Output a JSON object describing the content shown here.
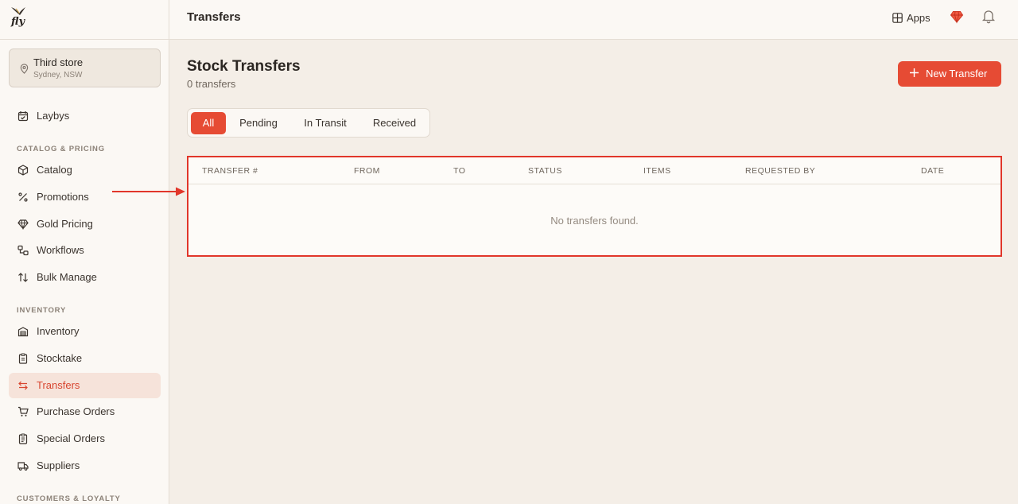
{
  "brand": {
    "logo_text": "fly"
  },
  "store": {
    "name": "Third store",
    "location": "Sydney, NSW"
  },
  "sidebar": {
    "top_items": [
      {
        "label": "Laybys",
        "icon": "calendar-check-icon"
      }
    ],
    "sections": [
      {
        "title": "CATALOG & PRICING",
        "items": [
          {
            "label": "Catalog",
            "icon": "box-icon"
          },
          {
            "label": "Promotions",
            "icon": "percent-icon"
          },
          {
            "label": "Gold Pricing",
            "icon": "diamond-icon"
          },
          {
            "label": "Workflows",
            "icon": "workflow-icon"
          },
          {
            "label": "Bulk Manage",
            "icon": "arrows-up-down-icon"
          }
        ]
      },
      {
        "title": "INVENTORY",
        "items": [
          {
            "label": "Inventory",
            "icon": "warehouse-icon"
          },
          {
            "label": "Stocktake",
            "icon": "clipboard-icon"
          },
          {
            "label": "Transfers",
            "icon": "transfer-arrows-icon",
            "active": true
          },
          {
            "label": "Purchase Orders",
            "icon": "cart-icon"
          },
          {
            "label": "Special Orders",
            "icon": "clipboard-list-icon"
          },
          {
            "label": "Suppliers",
            "icon": "truck-icon"
          }
        ]
      },
      {
        "title": "CUSTOMERS & LOYALTY",
        "items": []
      }
    ]
  },
  "topbar": {
    "title": "Transfers",
    "apps_label": "Apps"
  },
  "main": {
    "heading": "Stock Transfers",
    "count_text": "0 transfers",
    "new_button_label": "New Transfer",
    "tabs": [
      {
        "label": "All",
        "active": true
      },
      {
        "label": "Pending"
      },
      {
        "label": "In Transit"
      },
      {
        "label": "Received"
      }
    ],
    "table": {
      "columns": [
        "TRANSFER #",
        "FROM",
        "TO",
        "STATUS",
        "ITEMS",
        "REQUESTED BY",
        "DATE"
      ],
      "empty_text": "No transfers found."
    }
  },
  "colors": {
    "accent": "#e64b34",
    "highlight_border": "#e1362a",
    "sidebar_active_bg": "#f6e3da"
  }
}
